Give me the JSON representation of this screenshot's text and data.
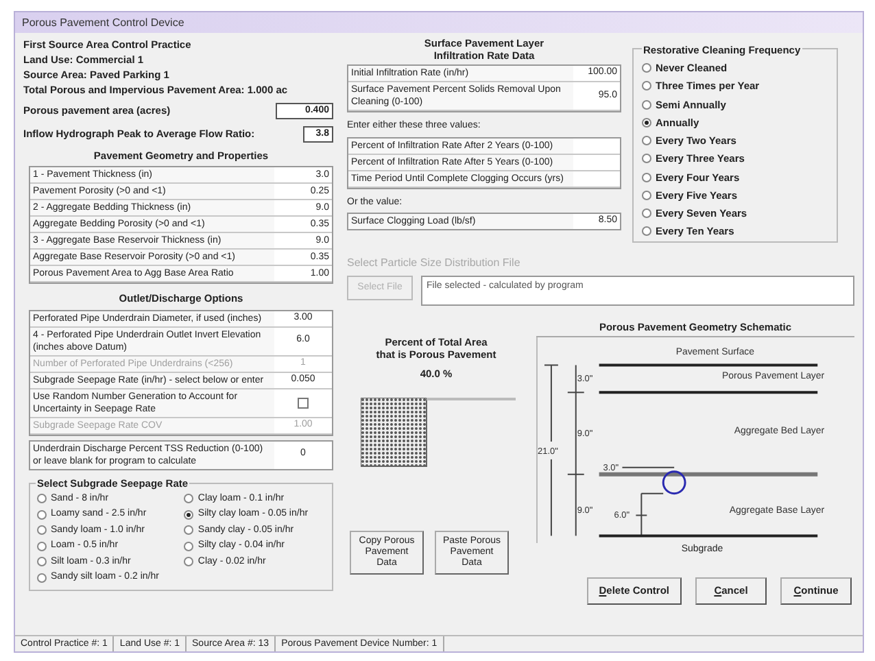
{
  "window": {
    "title": "Porous Pavement Control Device"
  },
  "header": {
    "lines": [
      "First Source Area Control Practice",
      "Land Use:  Commercial 1",
      "Source Area:  Paved Parking 1",
      "Total Porous and Impervious Pavement Area:  1.000 ac"
    ]
  },
  "porous_area": {
    "label": "Porous pavement area (acres)",
    "value": "0.400"
  },
  "inflow_ratio": {
    "label": "Inflow Hydrograph Peak to Average Flow Ratio:",
    "value": "3.8"
  },
  "geometry": {
    "title": "Pavement Geometry and Properties",
    "rows": [
      {
        "label": "1 - Pavement Thickness (in)",
        "value": "3.0"
      },
      {
        "label": "Pavement Porosity (>0 and <1)",
        "value": "0.25"
      },
      {
        "label": "2 - Aggregate Bedding Thickness (in)",
        "value": "9.0"
      },
      {
        "label": "Aggregate Bedding Porosity (>0 and <1)",
        "value": "0.35"
      },
      {
        "label": "3 - Aggregate Base Reservoir Thickness (in)",
        "value": "9.0"
      },
      {
        "label": "Aggregate Base Reservoir Porosity (>0 and <1)",
        "value": "0.35"
      },
      {
        "label": "Porous Pavement Area to Agg Base Area Ratio",
        "value": "1.00"
      }
    ]
  },
  "outlet": {
    "title": "Outlet/Discharge Options",
    "rows": [
      {
        "kind": "value",
        "label": "Perforated Pipe Underdrain Diameter, if used (inches)",
        "value": "3.00",
        "disabled": false
      },
      {
        "kind": "value",
        "label": "4 - Perforated Pipe Underdrain Outlet Invert Elevation (inches above Datum)",
        "value": "6.0",
        "disabled": false
      },
      {
        "kind": "value",
        "label": "Number of Perforated Pipe Underdrains (<256)",
        "value": "1",
        "disabled": true
      },
      {
        "kind": "value",
        "label": "Subgrade Seepage Rate (in/hr) - select below or enter",
        "value": "0.050",
        "disabled": false
      },
      {
        "kind": "checkbox",
        "label": "Use Random Number Generation to Account for Uncertainty in Seepage Rate",
        "checked": false,
        "disabled": false
      },
      {
        "kind": "value",
        "label": "Subgrade Seepage Rate COV",
        "value": "1.00",
        "disabled": true
      }
    ]
  },
  "tss": {
    "label": "Underdrain Discharge Percent TSS Reduction (0-100) or leave blank for program to calculate",
    "value": "0"
  },
  "seepage": {
    "title": "Select Subgrade Seepage Rate",
    "options": [
      {
        "label": "Sand - 8 in/hr",
        "selected": false
      },
      {
        "label": "Loamy sand - 2.5 in/hr",
        "selected": false
      },
      {
        "label": "Sandy loam - 1.0 in/hr",
        "selected": false
      },
      {
        "label": "Loam - 0.5 in/hr",
        "selected": false
      },
      {
        "label": "Silt loam - 0.3 in/hr",
        "selected": false
      },
      {
        "label": "Sandy silt loam - 0.2 in/hr",
        "selected": false
      },
      {
        "label": "Clay loam - 0.1 in/hr",
        "selected": false
      },
      {
        "label": "Silty clay loam - 0.05 in/hr",
        "selected": true
      },
      {
        "label": "Sandy clay - 0.05 in/hr",
        "selected": false
      },
      {
        "label": "Silty clay - 0.04 in/hr",
        "selected": false
      },
      {
        "label": "Clay - 0.02 in/hr",
        "selected": false
      }
    ]
  },
  "infiltration": {
    "title_lines": [
      "Surface Pavement Layer",
      "Infiltration Rate Data"
    ],
    "rows": [
      {
        "label": "Initial Infiltration Rate (in/hr)",
        "value": "100.00"
      },
      {
        "label": "Surface Pavement Percent Solids Removal Upon Cleaning (0-100)",
        "value": "95.0"
      }
    ],
    "either_label": "Enter either these three values:",
    "either_rows": [
      {
        "label": "Percent of Infiltration Rate After 2 Years (0-100)"
      },
      {
        "label": "Percent of Infiltration Rate After 5 Years (0-100)"
      },
      {
        "label": "Time Period Until Complete Clogging Occurs (yrs)"
      }
    ],
    "or_label": "Or the value:",
    "clogging": {
      "label": "Surface Clogging Load (lb/sf)",
      "value": "8.50"
    }
  },
  "particle": {
    "label": "Select Particle Size Distribution File",
    "disabled": true,
    "button": "Select File",
    "file": "File selected - calculated by program"
  },
  "cleaning": {
    "title": "Restorative Cleaning Frequency",
    "options": [
      {
        "label": "Never Cleaned",
        "selected": false
      },
      {
        "label": "Three Times per Year",
        "selected": false
      },
      {
        "label": "Semi Annually",
        "selected": false
      },
      {
        "label": "Annually",
        "selected": true
      },
      {
        "label": "Every Two Years",
        "selected": false
      },
      {
        "label": "Every Three Years",
        "selected": false
      },
      {
        "label": "Every Four Years",
        "selected": false
      },
      {
        "label": "Every Five Years",
        "selected": false
      },
      {
        "label": "Every Seven Years",
        "selected": false
      },
      {
        "label": "Every Ten Years",
        "selected": false
      }
    ]
  },
  "percent": {
    "title_lines": [
      "Percent of Total Area",
      "that is Porous Pavement"
    ],
    "value": "40.0 %"
  },
  "copy_buttons": [
    {
      "label_lines": [
        "Copy Porous",
        "Pavement",
        "Data"
      ]
    },
    {
      "label_lines": [
        "Paste Porous",
        "Pavement",
        "Data"
      ]
    }
  ],
  "schematic": {
    "title": "Porous Pavement Geometry  Schematic",
    "surface": "Pavement Surface",
    "layers": [
      "Porous Pavement Layer",
      "Aggregate Bed Layer",
      "Aggregate Base Layer"
    ],
    "subgrade": "Subgrade",
    "dims": [
      "3.0\"",
      "9.0\"",
      "9.0\""
    ],
    "total": "21.0\"",
    "pipe_diameter": "3.0\"",
    "pipe_elevation": "6.0\""
  },
  "actions": [
    {
      "label": "Delete Control",
      "mnemonic_underlined": true
    },
    {
      "label": "Cancel",
      "mnemonic_underlined": true
    },
    {
      "label": "Continue",
      "mnemonic_underlined": true
    }
  ],
  "status_bar": [
    "Control Practice #:  1",
    "Land Use #:  1",
    "Source Area #:  13",
    "Porous Pavement Device Number:  1"
  ]
}
